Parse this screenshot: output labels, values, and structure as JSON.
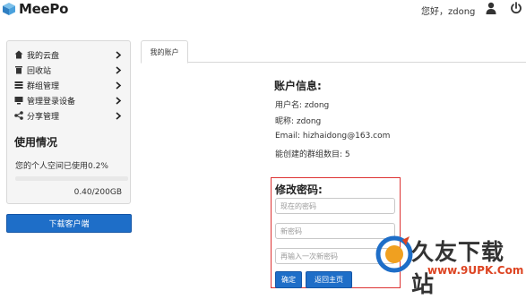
{
  "app": {
    "name": "MeePo"
  },
  "header": {
    "greeting": "您好，zdong"
  },
  "sidebar": {
    "items": [
      {
        "label": "我的云盘",
        "icon": "home-icon"
      },
      {
        "label": "回收站",
        "icon": "trash-icon"
      },
      {
        "label": "群组管理",
        "icon": "group-icon"
      },
      {
        "label": "管理登录设备",
        "icon": "device-icon"
      },
      {
        "label": "分享管理",
        "icon": "share-icon"
      }
    ],
    "usage": {
      "title": "使用情况",
      "text": "您的个人空间已使用0.2%",
      "size": "0.40/200GB",
      "percent": 0.2
    },
    "download_label": "下载客户端"
  },
  "main": {
    "tab": "我的账户",
    "account": {
      "title": "账户信息:",
      "username": "用户名: zdong",
      "nickname": "昵称: zdong",
      "email": "Email:  hizhaidong@163.com",
      "groups": "能创建的群组数目:  5"
    },
    "password": {
      "title": "修改密码:",
      "current_placeholder": "现在的密码",
      "new_placeholder": "新密码",
      "confirm_placeholder": "再输入一次新密码",
      "confirm_label": "确定",
      "back_label": "返回主页"
    }
  },
  "watermark": {
    "text": "久友下载站",
    "url": "www.9UPK.Com"
  },
  "colors": {
    "primary": "#1e6ec8",
    "highlight_border": "#dd3333"
  }
}
